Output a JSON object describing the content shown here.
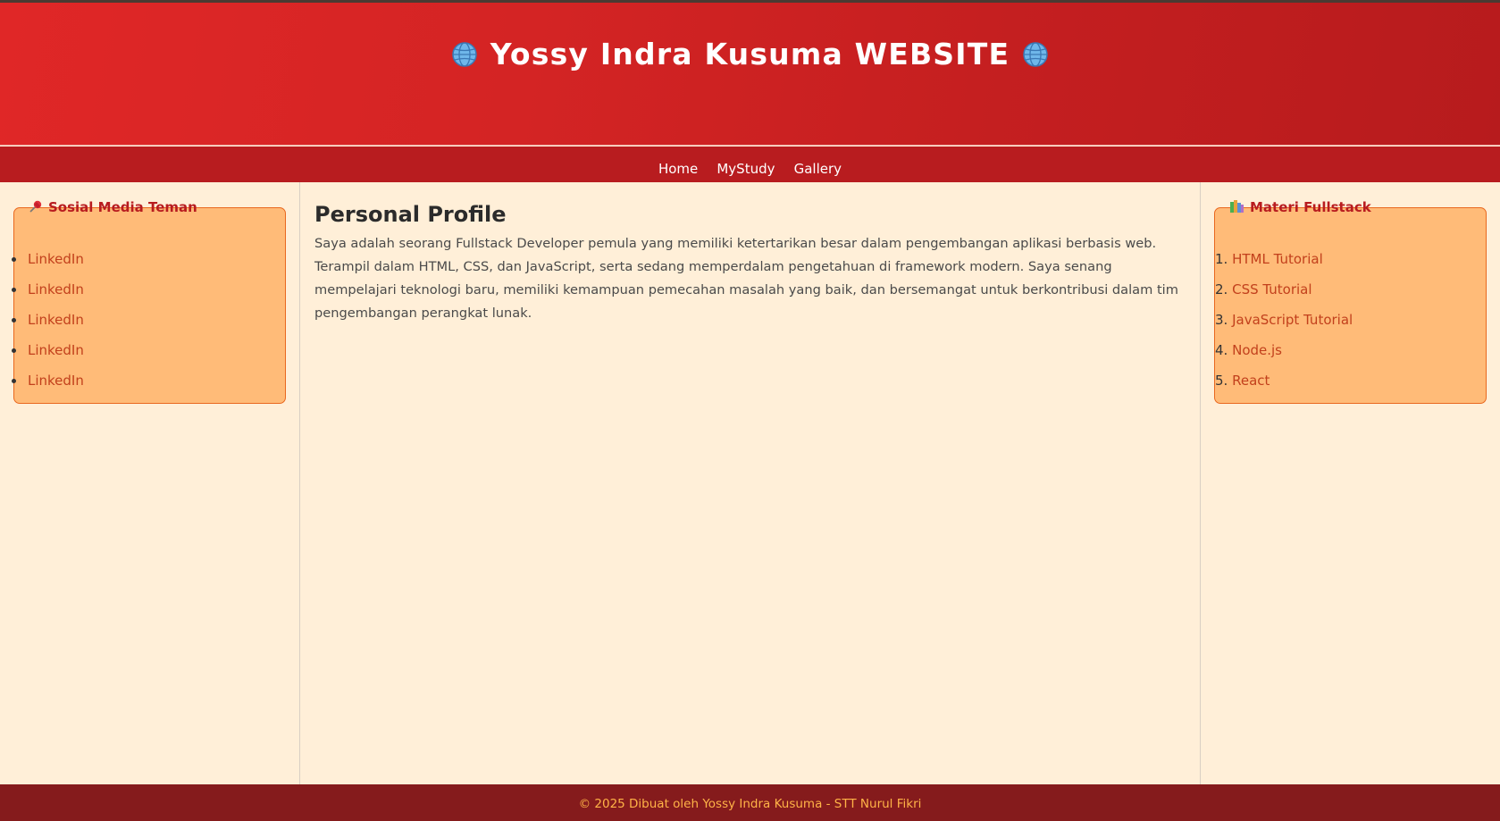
{
  "header": {
    "title": "Yossy Indra Kusuma WEBSITE",
    "icon_left": "globe-icon",
    "icon_right": "globe-icon"
  },
  "nav": {
    "items": [
      "Home",
      "MyStudy",
      "Gallery"
    ]
  },
  "left_sidebar": {
    "title": "Sosial Media Teman",
    "icon": "pushpin-icon",
    "links": [
      "LinkedIn",
      "LinkedIn",
      "LinkedIn",
      "LinkedIn",
      "LinkedIn"
    ]
  },
  "main": {
    "heading": "Personal Profile",
    "paragraph": "Saya adalah seorang Fullstack Developer pemula yang memiliki ketertarikan besar dalam pengembangan aplikasi berbasis web. Terampil dalam HTML, CSS, dan JavaScript, serta sedang memperdalam pengetahuan di framework modern. Saya senang mempelajari teknologi baru, memiliki kemampuan pemecahan masalah yang baik, dan bersemangat untuk berkontribusi dalam tim pengembangan perangkat lunak."
  },
  "right_sidebar": {
    "title": "Materi Fullstack",
    "icon": "books-icon",
    "numbers": [
      "1.",
      "2.",
      "3.",
      "4.",
      "5."
    ],
    "links": [
      "HTML Tutorial",
      "CSS Tutorial",
      "JavaScript Tutorial",
      "Node.js",
      "React"
    ]
  },
  "footer": {
    "text": "© 2025 Dibuat oleh Yossy Indra Kusuma - STT Nurul Fikri"
  },
  "colors": {
    "header_red": "#d42424",
    "nav_red": "#b81c1f",
    "footer_red": "#851b1c",
    "page_bg": "#ffefd8",
    "panel_bg": "#ffbb78",
    "link": "#c2401c",
    "footer_text": "#ffb347"
  }
}
